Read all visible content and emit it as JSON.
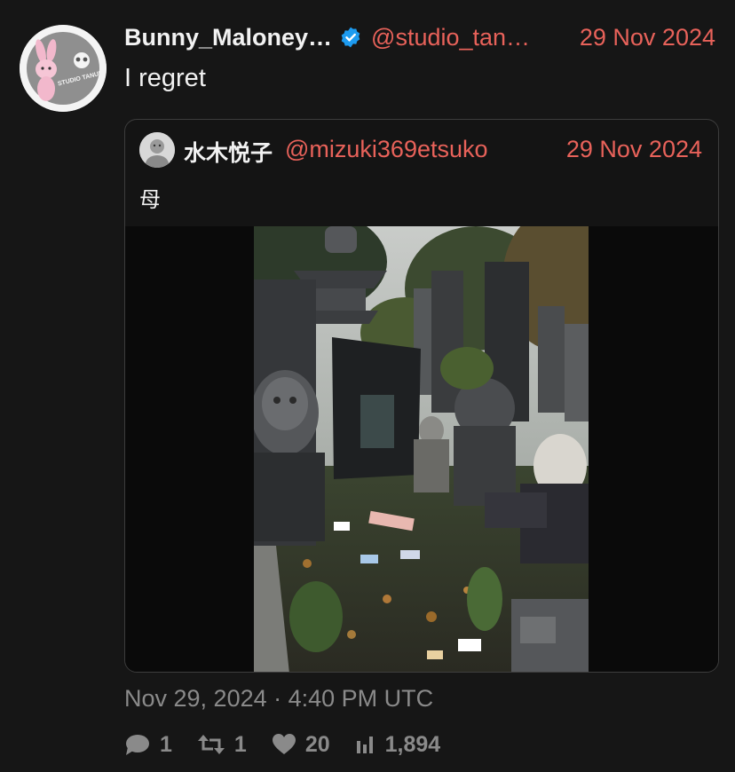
{
  "tweet": {
    "author": {
      "display_name": "Bunny_Maloney…",
      "handle": "@studio_tan…",
      "verified": true,
      "avatar_text": "STUDIO TANUKI"
    },
    "date": "29 Nov 2024",
    "text": "I regret",
    "timestamp": "Nov 29, 2024 · 4:40 PM UTC",
    "stats": {
      "replies": "1",
      "retweets": "1",
      "likes": "20",
      "views": "1,894"
    }
  },
  "quote": {
    "author": {
      "display_name": "水木悦子",
      "handle": "@mizuki369etsuko"
    },
    "date": "29 Nov 2024",
    "text": "母"
  },
  "colors": {
    "background": "#161616",
    "accent_link": "#e8625a",
    "verified_badge": "#1d9bf0",
    "muted": "#8a8a8a"
  }
}
